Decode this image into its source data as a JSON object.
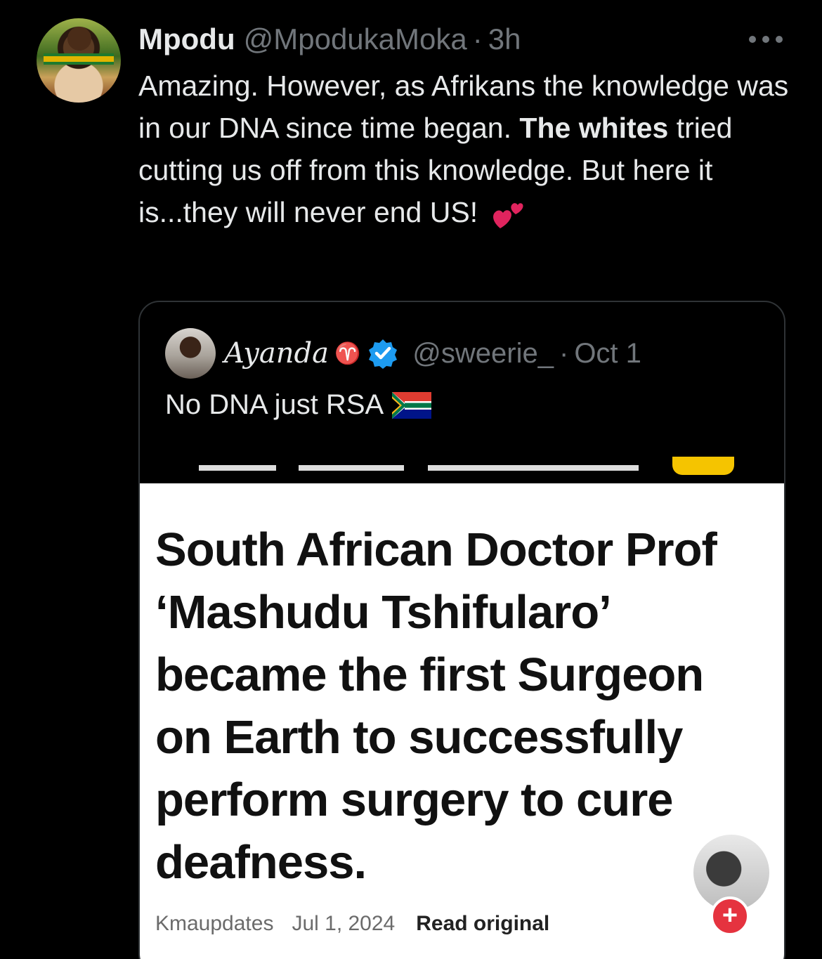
{
  "tweet": {
    "display_name": "Mpodu",
    "handle": "@MpodukaMoka",
    "separator": "·",
    "time": "3h",
    "text_part1": "Amazing. However, as Afrikans the knowledge was in our DNA since time began.",
    "text_bold": "The whites",
    "text_part2": "tried cutting us off from this knowledge. But here it is...they will never end US!",
    "emoji_name": "two-hearts-icon",
    "more_icon": "more-options-icon"
  },
  "quote": {
    "display_name": "Ayanda",
    "zodiac_sign": "♈",
    "verified": true,
    "handle": "@sweerie_",
    "separator": "·",
    "time": "Oct 1",
    "text": "No DNA just RSA",
    "flag_name": "south-africa-flag-icon",
    "media": {
      "headline": "South African Doctor Prof ‘Mashudu Tshifularo’ became the first Surgeon on Earth to successfully perform surgery to cure deafness.",
      "source": "Kmaupdates",
      "date": "Jul 1, 2024",
      "read_original": "Read original",
      "follow_symbol": "+"
    }
  },
  "colors": {
    "background": "#000000",
    "text": "#e7e9ea",
    "muted": "#71767b",
    "border": "#2f3336",
    "verified_blue": "#1d9bf0",
    "follow_red": "#e5333f"
  }
}
